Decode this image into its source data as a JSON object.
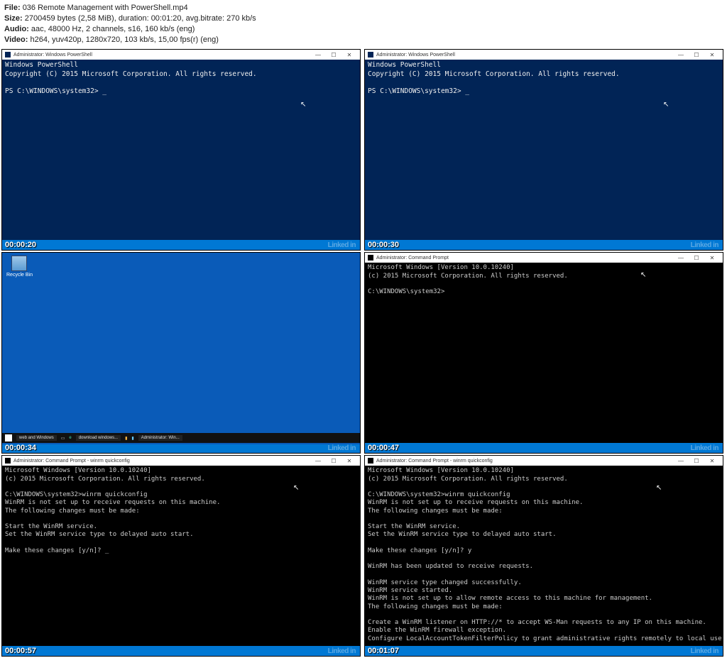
{
  "meta": {
    "file_label": "File:",
    "file_value": "036 Remote Management with PowerShell.mp4",
    "size_label": "Size:",
    "size_value": "2700459 bytes (2,58 MiB), duration: 00:01:20, avg.bitrate: 270 kb/s",
    "audio_label": "Audio:",
    "audio_value": "aac, 48000 Hz, 2 channels, s16, 160 kb/s (eng)",
    "video_label": "Video:",
    "video_value": "h264, yuv420p, 1280x720, 103 kb/s, 15,00 fps(r) (eng)"
  },
  "watermark": "Linked in",
  "window_titles": {
    "ps": "Administrator: Windows PowerShell",
    "cmd": "Administrator: Command Prompt",
    "cmd_quick": "Administrator: Command Prompt - winrm  quickconfig"
  },
  "ps_content": "Windows PowerShell\nCopyright (C) 2015 Microsoft Corporation. All rights reserved.\n\nPS C:\\WINDOWS\\system32> _",
  "cmd_plain": "Microsoft Windows [Version 10.0.10240]\n(c) 2015 Microsoft Corporation. All rights reserved.\n\nC:\\WINDOWS\\system32>",
  "cmd_quick_prompt": "Microsoft Windows [Version 10.0.10240]\n(c) 2015 Microsoft Corporation. All rights reserved.\n\nC:\\WINDOWS\\system32>winrm quickconfig\nWinRM is not set up to receive requests on this machine.\nThe following changes must be made:\n\nStart the WinRM service.\nSet the WinRM service type to delayed auto start.\n\nMake these changes [y/n]? _",
  "cmd_quick_full": "Microsoft Windows [Version 10.0.10240]\n(c) 2015 Microsoft Corporation. All rights reserved.\n\nC:\\WINDOWS\\system32>winrm quickconfig\nWinRM is not set up to receive requests on this machine.\nThe following changes must be made:\n\nStart the WinRM service.\nSet the WinRM service type to delayed auto start.\n\nMake these changes [y/n]? y\n\nWinRM has been updated to receive requests.\n\nWinRM service type changed successfully.\nWinRM service started.\nWinRM is not set up to allow remote access to this machine for management.\nThe following changes must be made:\n\nCreate a WinRM listener on HTTP://* to accept WS-Man requests to any IP on this machine.\nEnable the WinRM firewall exception.\nConfigure LocalAccountTokenFilterPolicy to grant administrative rights remotely to local users.\n\nMake these changes [y/n]? _",
  "desktop": {
    "recycle_label": "Recycle Bin",
    "taskbar_search": "web and Windows",
    "taskbar_download": "download windows...",
    "taskbar_admin": "Administrator: Win..."
  },
  "timestamps": {
    "f1": "00:00:20",
    "f2": "00:00:30",
    "f3": "00:00:34",
    "f4": "00:00:47",
    "f5": "00:00:57",
    "f6": "00:01:07"
  },
  "win_controls": {
    "min": "—",
    "max": "☐",
    "close": "✕"
  }
}
